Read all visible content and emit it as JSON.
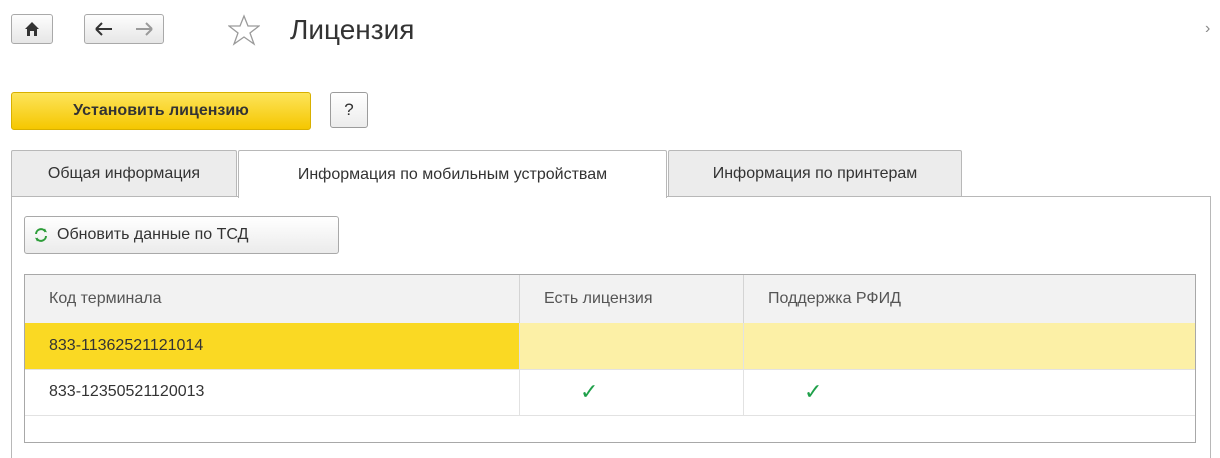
{
  "header": {
    "title": "Лицензия",
    "home_icon": "home-icon",
    "back_icon": "arrow-left-icon",
    "forward_icon": "arrow-right-icon",
    "favorite_icon": "star-outline-icon",
    "more_icon": "chevron-right-icon"
  },
  "toolbar": {
    "install_label": "Установить лицензию",
    "help_label": "?"
  },
  "tabs": [
    {
      "label": "Общая информация",
      "active": false
    },
    {
      "label": "Информация по мобильным устройствам",
      "active": true
    },
    {
      "label": "Информация по принтерам",
      "active": false
    }
  ],
  "panel": {
    "refresh_label": "Обновить данные по ТСД",
    "refresh_icon": "refresh-icon"
  },
  "table": {
    "columns": [
      "Код терминала",
      "Есть лицензия",
      "Поддержка РФИД"
    ],
    "rows": [
      {
        "code": "833-11362521121014",
        "has_license": false,
        "rfid": false,
        "selected": true
      },
      {
        "code": "833-12350521120013",
        "has_license": true,
        "rfid": true,
        "selected": false
      }
    ]
  },
  "colors": {
    "accent_yellow": "#f5c700",
    "selected_row": "#fad923",
    "check_green": "#1fa04a"
  }
}
